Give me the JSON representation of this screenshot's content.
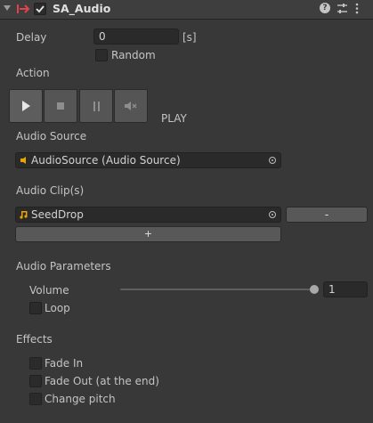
{
  "header": {
    "title": "SA_Audio",
    "enabled": true,
    "icons": [
      "foldout-arrow-icon",
      "script-component-icon",
      "help-icon",
      "preset-icon",
      "more-icon"
    ]
  },
  "delay": {
    "label": "Delay",
    "value": "0",
    "unit": "[s]"
  },
  "random": {
    "label": "Random",
    "checked": false
  },
  "action": {
    "label": "Action",
    "buttons": [
      "play-icon",
      "stop-icon",
      "pause-icon",
      "mute-icon"
    ],
    "status": "PLAY"
  },
  "audio_source": {
    "label": "Audio Source",
    "value": "AudioSource (Audio Source)"
  },
  "audio_clips": {
    "label": "Audio Clip(s)",
    "items": [
      {
        "value": "SeedDrop",
        "remove_label": "-"
      }
    ],
    "add_label": "+"
  },
  "audio_parameters": {
    "label": "Audio Parameters",
    "volume_label": "Volume",
    "volume_value": "1",
    "volume_level": 1.0,
    "loop_label": "Loop",
    "loop_checked": false
  },
  "effects": {
    "label": "Effects",
    "options": [
      {
        "label": "Fade In",
        "checked": false
      },
      {
        "label": "Fade Out (at the end)",
        "checked": false
      },
      {
        "label": "Change pitch",
        "checked": false
      }
    ]
  },
  "colors": {
    "background": "#383838",
    "header": "#3e3e3e",
    "script_icon": "#e0434b",
    "audio_icon": "#e8a400"
  }
}
